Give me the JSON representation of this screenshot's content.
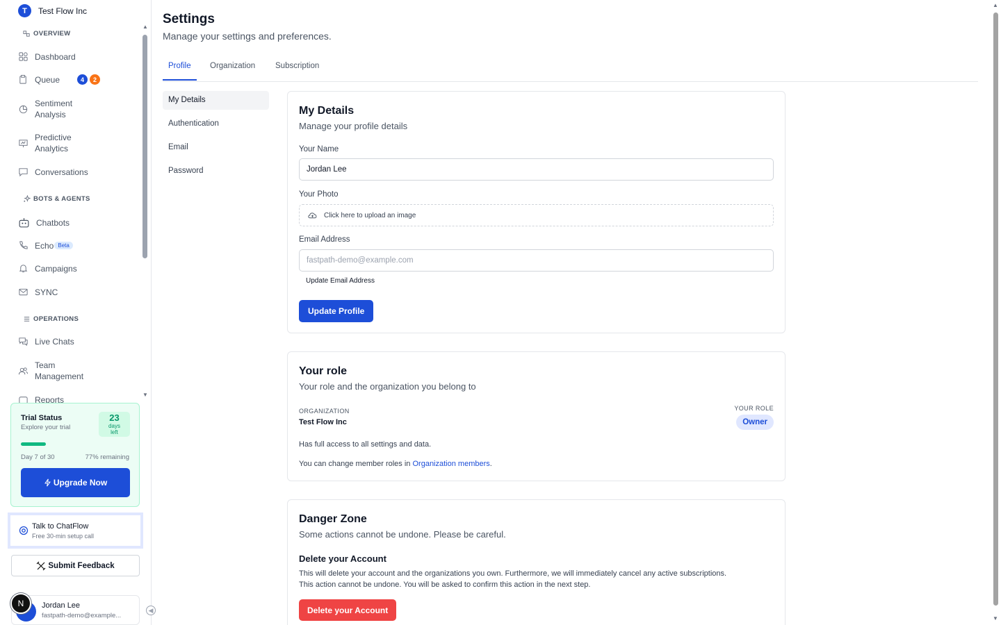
{
  "org": {
    "initial": "T",
    "name": "Test Flow Inc"
  },
  "sidebar": {
    "sections": [
      {
        "title": "OVERVIEW",
        "icon": "layout-icon"
      },
      {
        "title": "BOTS & AGENTS",
        "icon": "sparkles-icon"
      },
      {
        "title": "OPERATIONS",
        "icon": "list-icon"
      }
    ],
    "items": [
      {
        "label": "Dashboard",
        "icon": "grid-icon"
      },
      {
        "label": "Queue",
        "icon": "clipboard-icon",
        "badges": [
          "4",
          "2"
        ]
      },
      {
        "label": "Sentiment Analysis",
        "icon": "pie-chart-icon"
      },
      {
        "label": "Predictive Analytics",
        "icon": "presentation-icon"
      },
      {
        "label": "Conversations",
        "icon": "message-icon"
      },
      {
        "label": "Chatbots",
        "icon": "bot-icon"
      },
      {
        "label": "Echo",
        "icon": "phone-icon",
        "tag": "Beta"
      },
      {
        "label": "Campaigns",
        "icon": "bell-icon"
      },
      {
        "label": "SYNC",
        "icon": "mail-icon"
      },
      {
        "label": "Live Chats",
        "icon": "chat-bubbles-icon"
      },
      {
        "label": "Team Management",
        "icon": "users-icon"
      },
      {
        "label": "Reports",
        "icon": "report-icon"
      }
    ]
  },
  "trial": {
    "title": "Trial Status",
    "subtitle": "Explore your trial",
    "days_number": "23",
    "days_label": "days left",
    "progress_fraction": 0.23,
    "day_text": "Day 7 of 30",
    "remaining_text": "77% remaining",
    "upgrade_label": "Upgrade Now",
    "accent": "#10b981"
  },
  "talk": {
    "title": "Talk to ChatFlow",
    "subtitle": "Free 30-min setup call"
  },
  "feedback_label": "Submit Feedback",
  "user": {
    "name": "Jordan Lee",
    "email": "fastpath-demo@example...",
    "bubble": "N"
  },
  "page": {
    "title": "Settings",
    "subtitle": "Manage your settings and preferences."
  },
  "tabs": [
    "Profile",
    "Organization",
    "Subscription"
  ],
  "subnav": [
    "My Details",
    "Authentication",
    "Email",
    "Password"
  ],
  "details": {
    "title": "My Details",
    "subtitle": "Manage your profile details",
    "name_label": "Your Name",
    "name_value": "Jordan Lee",
    "photo_label": "Your Photo",
    "upload_text": "Click here to upload an image",
    "email_label": "Email Address",
    "email_value": "fastpath-demo@example.com",
    "update_email": "Update Email Address",
    "update_profile": "Update Profile"
  },
  "role": {
    "title": "Your role",
    "subtitle": "Your role and the organization you belong to",
    "org_caption": "ORGANIZATION",
    "org_name": "Test Flow Inc",
    "role_caption": "YOUR ROLE",
    "role_value": "Owner",
    "access_text": "Has full access to all settings and data.",
    "change_text": "You can change member roles in",
    "change_link": "Organization members",
    "change_end": "."
  },
  "danger": {
    "title": "Danger Zone",
    "subtitle": "Some actions cannot be undone. Please be careful.",
    "delete_heading": "Delete your Account",
    "delete_text_1": "This will delete your account and the organizations you own. Furthermore, we will immediately cancel any active subscriptions.",
    "delete_text_2": "This action cannot be undone. You will be asked to confirm this action in the next step.",
    "delete_button": "Delete your Account"
  },
  "colors": {
    "primary": "#1d4ed8",
    "danger": "#ef4444",
    "success": "#10b981"
  }
}
